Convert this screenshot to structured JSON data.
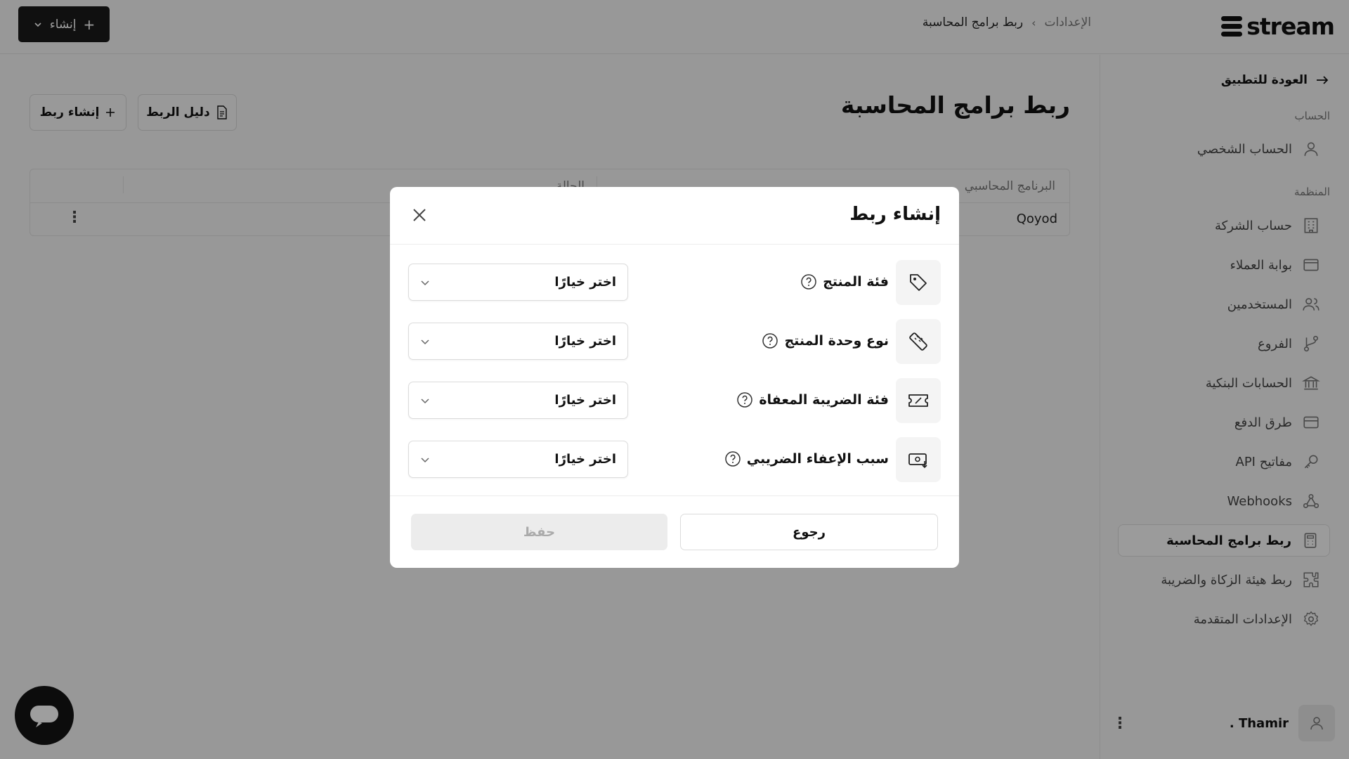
{
  "app": {
    "logo_text": "stream"
  },
  "header": {
    "breadcrumb_root": "الإعدادات",
    "breadcrumb_sep": "›",
    "breadcrumb_current": "ربط برامج المحاسبة",
    "create_label": "إنشاء",
    "create_plus": "+"
  },
  "sidebar": {
    "back_label": "العودة للتطبيق",
    "section_account": "الحساب",
    "section_org": "المنظمة",
    "account_items": [
      {
        "label": "الحساب الشخصي",
        "icon": "user-icon"
      }
    ],
    "org_items": [
      {
        "label": "حساب الشركة",
        "icon": "building-icon"
      },
      {
        "label": "بوابة العملاء",
        "icon": "window-icon"
      },
      {
        "label": "المستخدمين",
        "icon": "users-icon"
      },
      {
        "label": "الفروع",
        "icon": "branch-icon"
      },
      {
        "label": "الحسابات البنكية",
        "icon": "bank-icon"
      },
      {
        "label": "طرق الدفع",
        "icon": "card-icon"
      },
      {
        "label": "مفاتيح API",
        "icon": "key-icon"
      },
      {
        "label": "Webhooks",
        "icon": "webhook-icon"
      },
      {
        "label": "ربط برامج المحاسبة",
        "icon": "calculator-icon",
        "active": true
      },
      {
        "label": "ربط هيئة الزكاة والضريبة",
        "icon": "puzzle-icon"
      },
      {
        "label": "الإعدادات المتقدمة",
        "icon": "gear-icon"
      }
    ],
    "user_name": "Thamir ."
  },
  "main": {
    "title": "ربط برامج المحاسبة",
    "guide_button": "دليل الربط",
    "create_link_button": "إنشاء ربط",
    "table": {
      "headers": [
        "البرنامج المحاسبي",
        "الحالة"
      ],
      "rows": [
        {
          "program": "Qoyod"
        }
      ]
    }
  },
  "modal": {
    "title": "إنشاء ربط",
    "fields": [
      {
        "label": "فئة المنتج",
        "placeholder": "اختر خيارًا",
        "icon": "tag-icon"
      },
      {
        "label": "نوع وحدة المنتج",
        "placeholder": "اختر خيارًا",
        "icon": "ruler-icon"
      },
      {
        "label": "فئة الضريبة المعفاة",
        "placeholder": "اختر خيارًا",
        "icon": "ticket-icon"
      },
      {
        "label": "سبب الإعفاء الضريبي",
        "placeholder": "اختر خيارًا",
        "icon": "cash-receive-icon"
      }
    ],
    "back_button": "رجوع",
    "save_button": "حفظ"
  },
  "colors": {
    "primary": "#111111",
    "overlay": "rgba(0,0,0,0.38)",
    "disabled": "#ececec"
  }
}
